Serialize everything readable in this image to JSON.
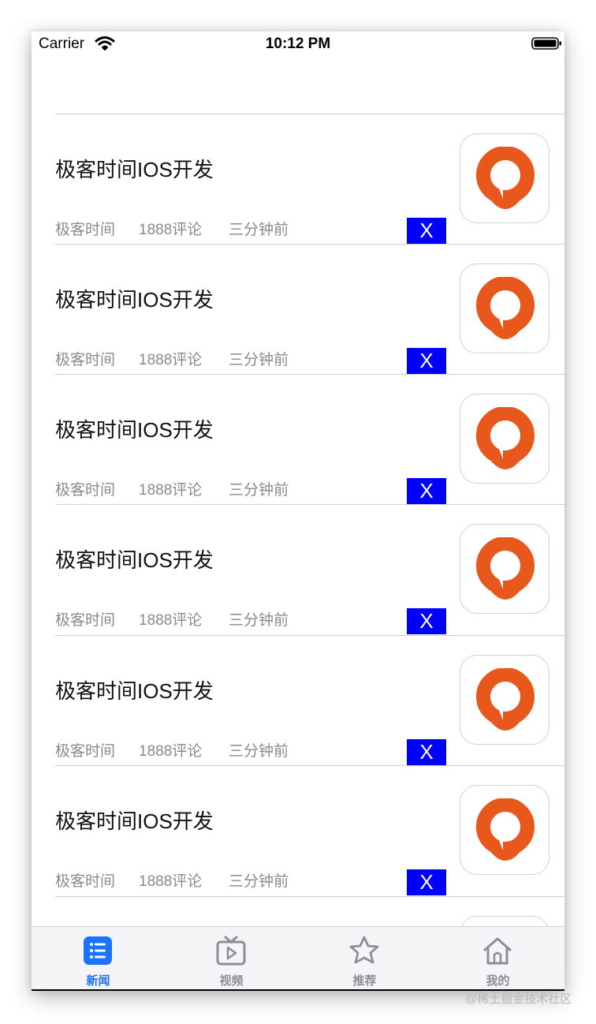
{
  "status_bar": {
    "carrier": "Carrier",
    "time": "10:12 PM"
  },
  "feed": {
    "rows": [
      {
        "title": "极客时间IOS开发",
        "source": "极客时间",
        "comments": "1888评论",
        "time": "三分钟前",
        "close": "X"
      },
      {
        "title": "极客时间IOS开发",
        "source": "极客时间",
        "comments": "1888评论",
        "time": "三分钟前",
        "close": "X"
      },
      {
        "title": "极客时间IOS开发",
        "source": "极客时间",
        "comments": "1888评论",
        "time": "三分钟前",
        "close": "X"
      },
      {
        "title": "极客时间IOS开发",
        "source": "极客时间",
        "comments": "1888评论",
        "time": "三分钟前",
        "close": "X"
      },
      {
        "title": "极客时间IOS开发",
        "source": "极客时间",
        "comments": "1888评论",
        "time": "三分钟前",
        "close": "X"
      },
      {
        "title": "极客时间IOS开发",
        "source": "极客时间",
        "comments": "1888评论",
        "time": "三分钟前",
        "close": "X"
      }
    ]
  },
  "tab_bar": {
    "tabs": [
      {
        "label": "新闻",
        "icon": "news-list-icon",
        "active": true
      },
      {
        "label": "视频",
        "icon": "video-tv-icon",
        "active": false
      },
      {
        "label": "推荐",
        "icon": "star-icon",
        "active": false
      },
      {
        "label": "我的",
        "icon": "home-icon",
        "active": false
      }
    ]
  },
  "watermark": "@稀土掘金技术社区",
  "colors": {
    "accent": "#1a73ff",
    "close_button": "#0000ff",
    "logo_orange": "#e8581c"
  }
}
